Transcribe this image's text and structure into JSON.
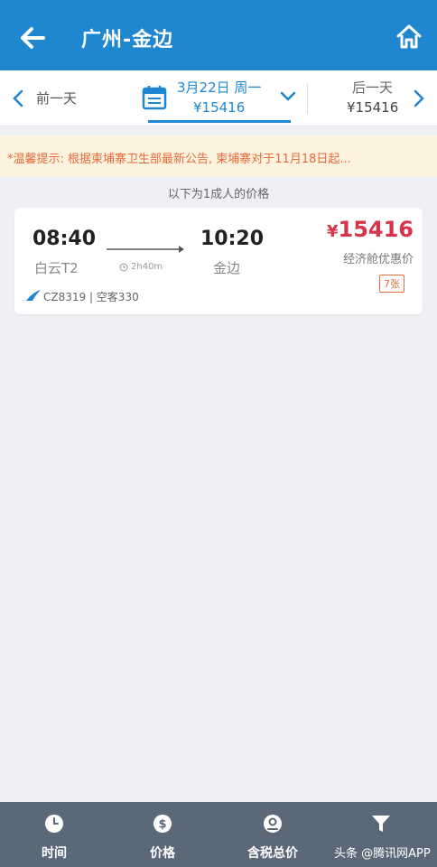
{
  "header": {
    "title": "广州-金边"
  },
  "datebar": {
    "prev_label": "前一天",
    "selected_date": "3月22日 周一",
    "selected_price": "¥15416",
    "next_label": "后一天",
    "next_price": "¥15416"
  },
  "notice": {
    "text": "*温馨提示: 根据柬埔寨卫生部最新公告, 柬埔寨对于11月18日起..."
  },
  "adult_note": "以下为1成人的价格",
  "flight": {
    "dep_time": "08:40",
    "dep_airport": "白云T2",
    "duration": "2h40m",
    "arr_time": "10:20",
    "arr_airport": "金边",
    "price_symbol": "¥",
    "price_value": "15416",
    "cabin": "经济舱优惠价",
    "seats": "7张",
    "flight_info": "CZ8319 | 空客330"
  },
  "bottom_tabs": {
    "time": "时间",
    "price": "价格",
    "tax": "含税总价",
    "filter": "筛选"
  },
  "watermark": "头条 @腾讯网APP",
  "colors": {
    "brand": "#1f86d0",
    "price": "#d9324a",
    "notice": "#e56a3c",
    "bottombar": "#5a6878"
  }
}
